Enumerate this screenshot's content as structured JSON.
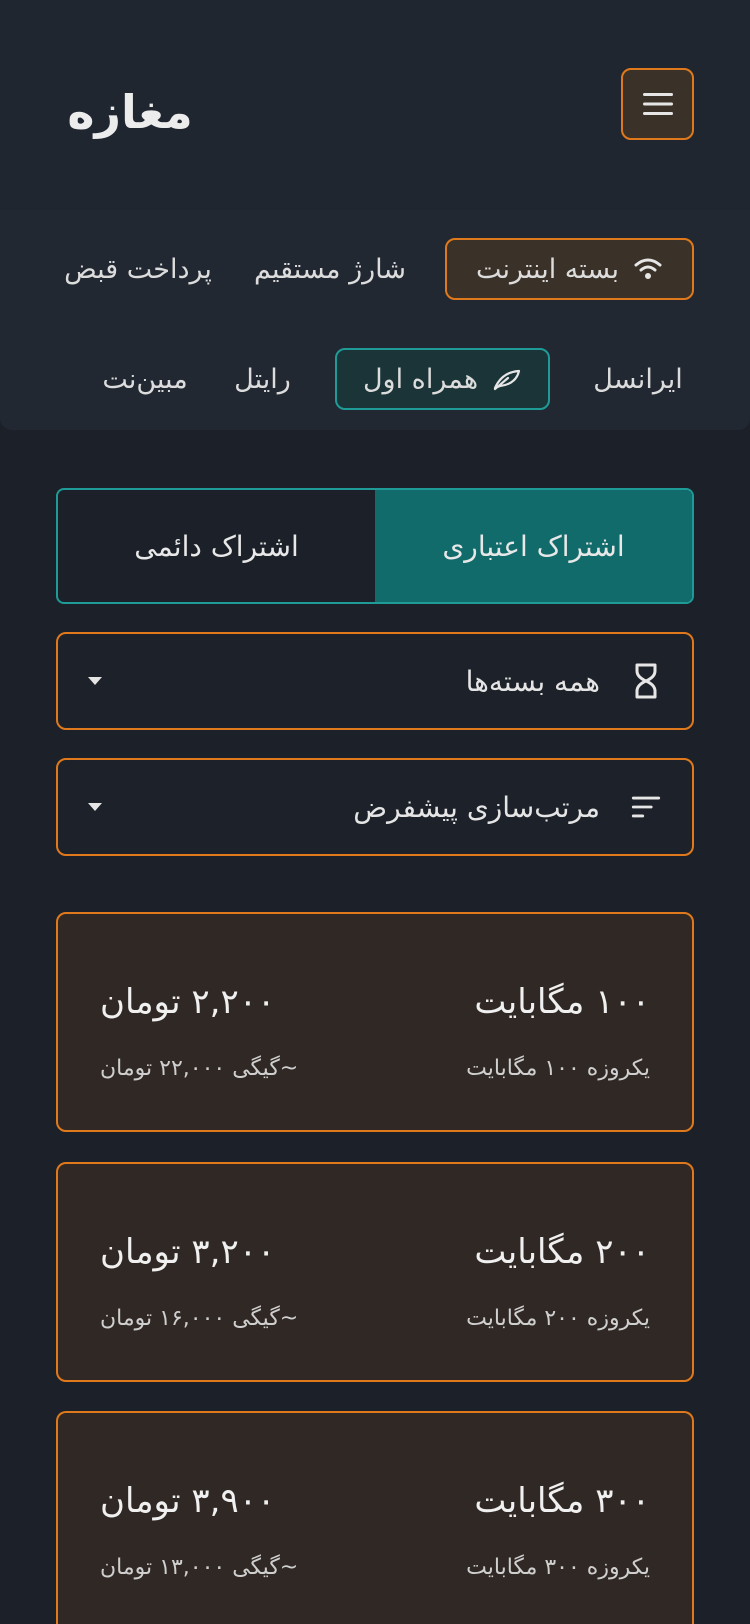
{
  "header": {
    "logo_text": "مغازه",
    "menu_icon": "hamburger-icon",
    "accent_color": "#e0791b"
  },
  "services": [
    {
      "label": "بسته اینترنت",
      "icon": "wifi-icon",
      "active": true
    },
    {
      "label": "شارژ مستقیم",
      "active": false
    },
    {
      "label": "پرداخت قبض",
      "active": false
    }
  ],
  "operators": [
    {
      "label": "ایرانسل",
      "active": false
    },
    {
      "label": "همراه اول",
      "icon": "feather-icon",
      "active": true
    },
    {
      "label": "رایتل",
      "active": false
    },
    {
      "label": "مبین‌نت",
      "active": false
    }
  ],
  "subscription": {
    "options": [
      "اشتراک اعتباری",
      "اشتراک دائمی"
    ],
    "selected": "اشتراک اعتباری",
    "active_color": "#126b6b"
  },
  "filters": {
    "duration": {
      "value": "همه بسته‌ها",
      "icon": "hourglass-icon"
    },
    "sort": {
      "value": "مرتب‌سازی پیشفرض",
      "icon": "sort-icon"
    }
  },
  "packages": [
    {
      "size": "۱۰۰ مگابایت",
      "price": "۲,۲۰۰ تومان",
      "desc": "یکروزه ۱۰۰ مگابایت",
      "per_gig": "~گیگی ۲۲,۰۰۰ تومان"
    },
    {
      "size": "۲۰۰ مگابایت",
      "price": "۳,۲۰۰ تومان",
      "desc": "یکروزه ۲۰۰ مگابایت",
      "per_gig": "~گیگی ۱۶,۰۰۰ تومان"
    },
    {
      "size": "۳۰۰ مگابایت",
      "price": "۳,۹۰۰ تومان",
      "desc": "یکروزه ۳۰۰ مگابایت",
      "per_gig": "~گیگی ۱۳,۰۰۰ تومان"
    }
  ]
}
